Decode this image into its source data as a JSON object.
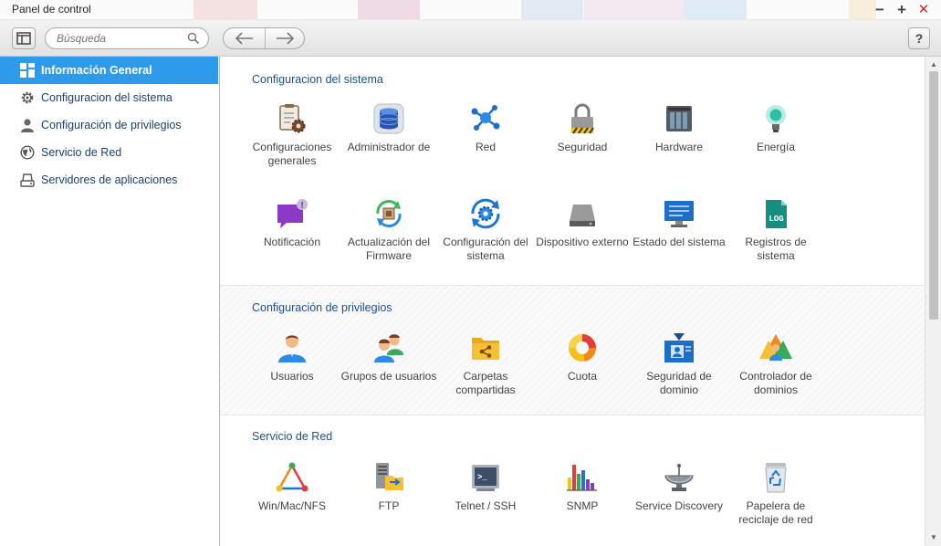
{
  "window": {
    "title": "Panel de control",
    "controls": {
      "minimize": "−",
      "maximize": "+",
      "close": "✕"
    }
  },
  "toolbar": {
    "search_placeholder": "Búsqueda",
    "back_glyph": "←",
    "forward_glyph": "→",
    "help_label": "?"
  },
  "sidebar": {
    "items": [
      {
        "label": "Información General",
        "icon": "grid-icon",
        "active": true
      },
      {
        "label": "Configuracion del sistema",
        "icon": "gear-icon"
      },
      {
        "label": "Configuración de privilegios",
        "icon": "user-icon"
      },
      {
        "label": "Servicio de Red",
        "icon": "globe-icon"
      },
      {
        "label": "Servidores de aplicaciones",
        "icon": "server-icon"
      }
    ]
  },
  "sections": [
    {
      "title": "Configuracion del sistema",
      "apps": [
        {
          "label": "Configuraciones generales",
          "icon": "clipboard-gear-icon"
        },
        {
          "label": "Administrador de",
          "icon": "database-icon"
        },
        {
          "label": "Red",
          "icon": "network-icon"
        },
        {
          "label": "Seguridad",
          "icon": "padlock-icon"
        },
        {
          "label": "Hardware",
          "icon": "hardware-icon"
        },
        {
          "label": "Energía",
          "icon": "lightbulb-icon"
        },
        {
          "label": "Notificación",
          "icon": "notification-icon"
        },
        {
          "label": "Actualización del Firmware",
          "icon": "firmware-update-icon"
        },
        {
          "label": "Configuración del sistema",
          "icon": "system-config-icon"
        },
        {
          "label": "Dispositivo externo",
          "icon": "external-drive-icon"
        },
        {
          "label": "Estado del sistema",
          "icon": "monitor-icon"
        },
        {
          "label": "Registros de sistema",
          "icon": "log-file-icon",
          "badge": "LOG"
        }
      ]
    },
    {
      "title": "Configuración de privilegios",
      "apps": [
        {
          "label": "Usuarios",
          "icon": "user-icon"
        },
        {
          "label": "Grupos de usuarios",
          "icon": "user-group-icon"
        },
        {
          "label": "Carpetas compartidas",
          "icon": "shared-folder-icon"
        },
        {
          "label": "Cuota",
          "icon": "quota-pie-icon"
        },
        {
          "label": "Seguridad de dominio",
          "icon": "domain-security-icon"
        },
        {
          "label": "Controlador de dominios",
          "icon": "domain-controller-icon"
        }
      ]
    },
    {
      "title": "Servicio de Red",
      "apps": [
        {
          "label": "Win/Mac/NFS",
          "icon": "triangle-network-icon"
        },
        {
          "label": "FTP",
          "icon": "ftp-icon"
        },
        {
          "label": "Telnet / SSH",
          "icon": "terminal-icon",
          "badge": ">_"
        },
        {
          "label": "SNMP",
          "icon": "bar-chart-icon"
        },
        {
          "label": "Service Discovery",
          "icon": "satellite-dish-icon"
        },
        {
          "label": "Papelera de reciclaje de red",
          "icon": "recycle-bin-icon"
        }
      ]
    }
  ],
  "colors": {
    "accent": "#2d9bea",
    "section_title": "#1f4f86",
    "sidebar_text": "#1f3e66",
    "close_red": "#d9272e"
  }
}
